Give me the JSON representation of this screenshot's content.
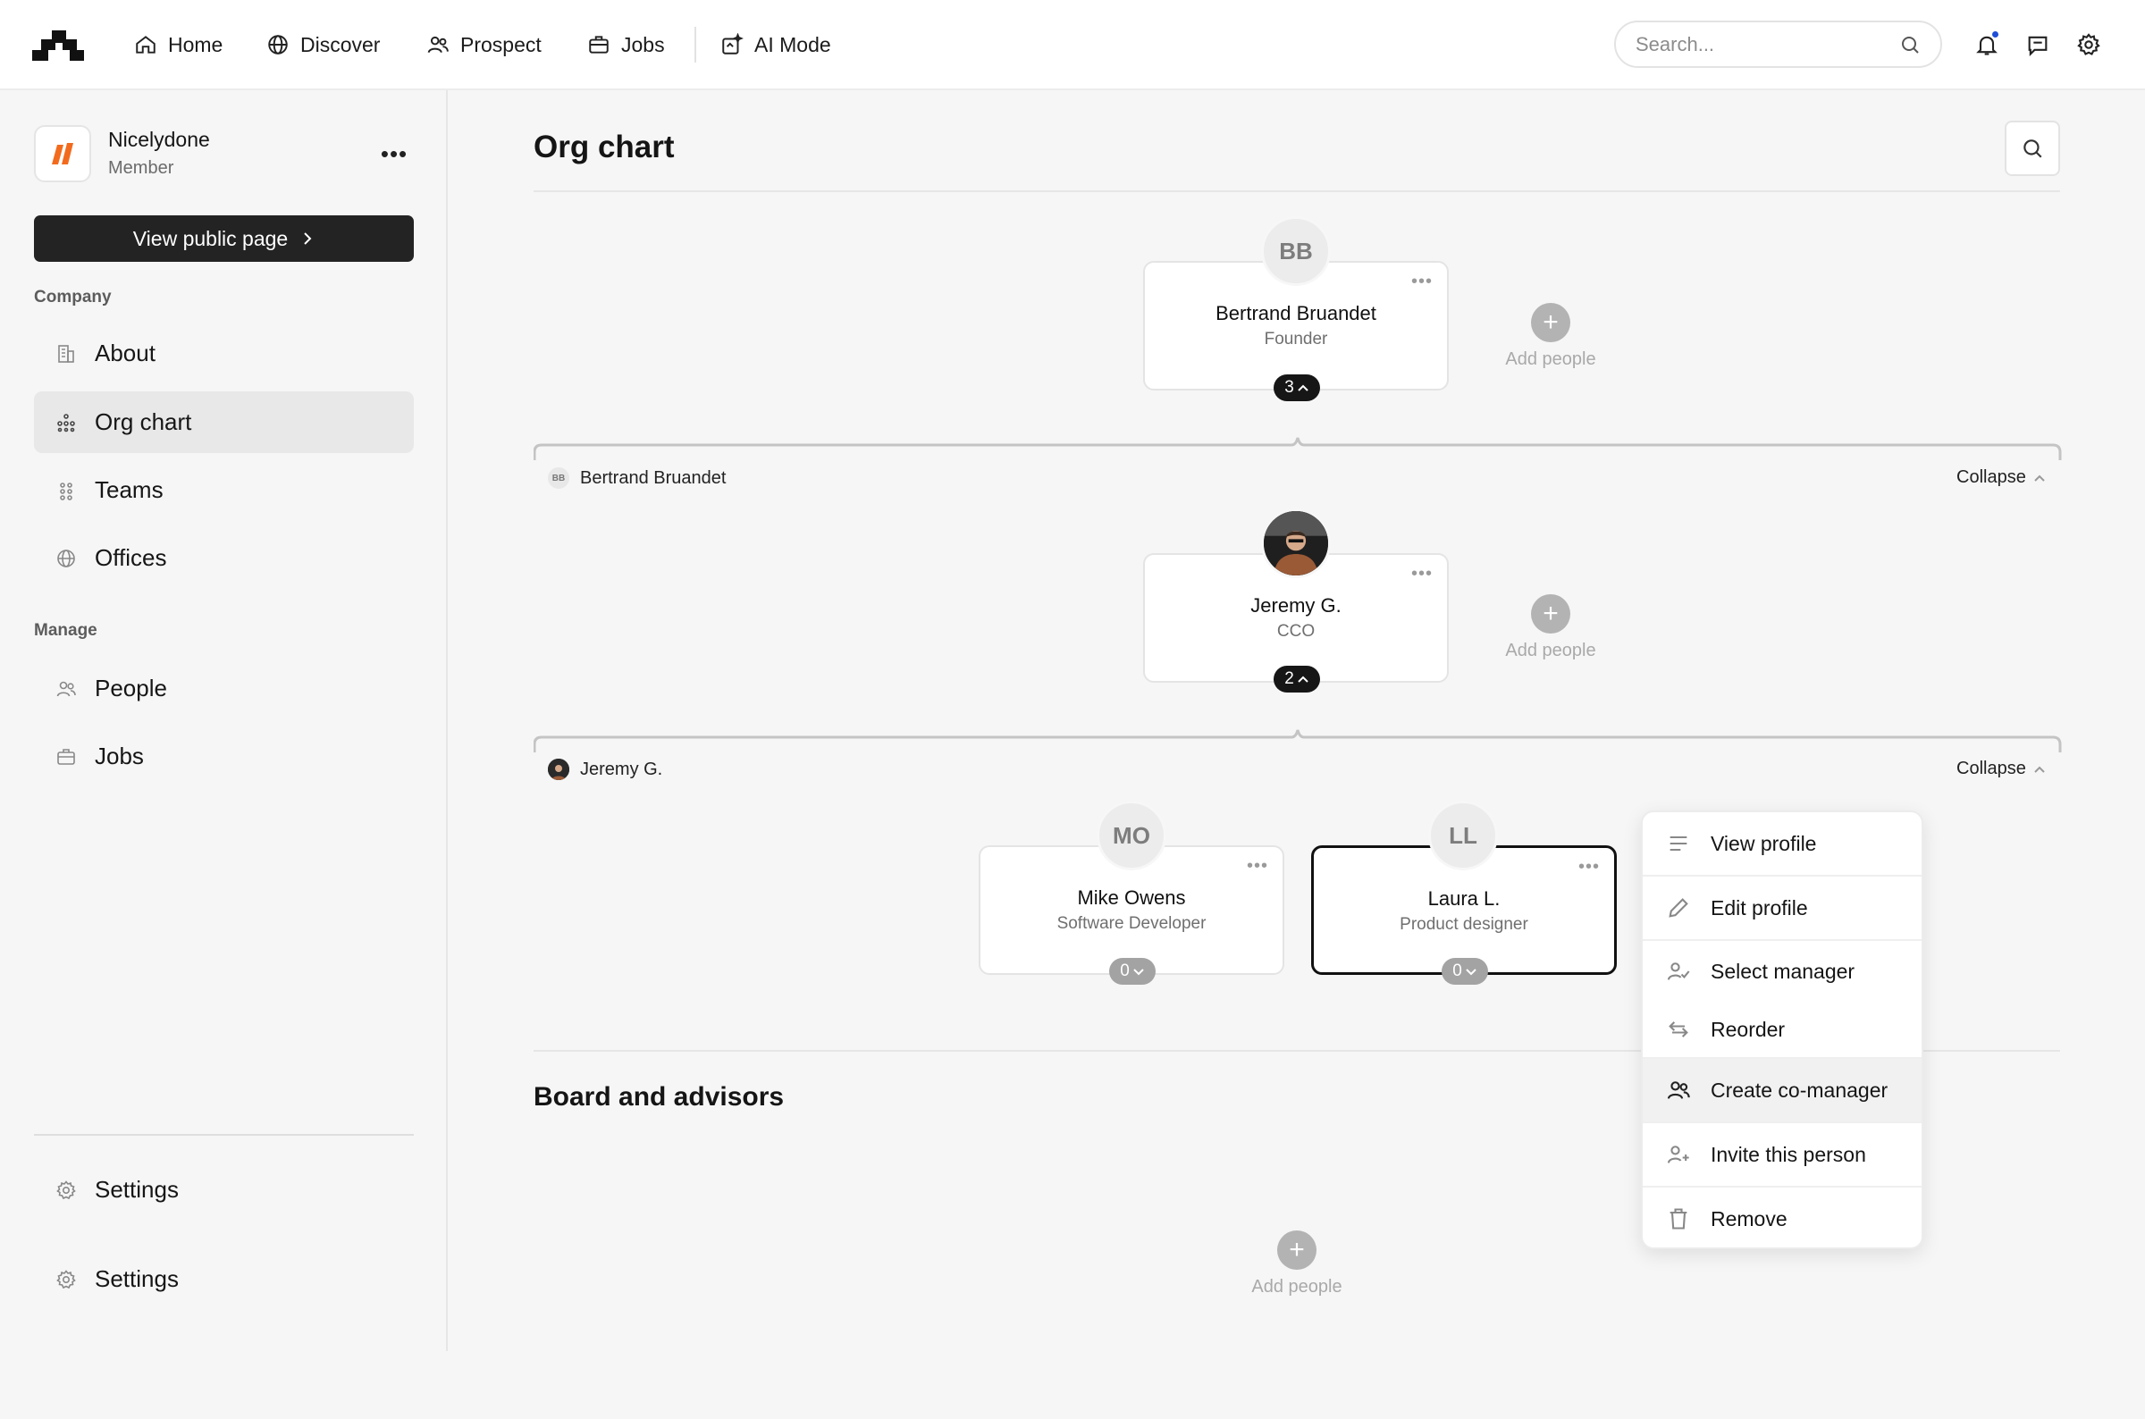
{
  "topbar": {
    "nav": [
      {
        "label": "Home",
        "icon": "home-icon"
      },
      {
        "label": "Discover",
        "icon": "globe-icon"
      },
      {
        "label": "Prospect",
        "icon": "users-icon"
      },
      {
        "label": "Jobs",
        "icon": "briefcase-icon"
      },
      {
        "label": "AI Mode",
        "icon": "ai-sparkle-icon"
      }
    ],
    "search_placeholder": "Search..."
  },
  "sidebar": {
    "company_name": "Nicelydone",
    "company_role": "Member",
    "more_label": "•••",
    "public_button": "View public page",
    "company_section": "Company",
    "manage_section": "Manage",
    "company_items": [
      {
        "label": "About",
        "icon": "building-icon"
      },
      {
        "label": "Org chart",
        "icon": "org-chart-icon"
      },
      {
        "label": "Teams",
        "icon": "teams-icon"
      },
      {
        "label": "Offices",
        "icon": "globe-icon"
      }
    ],
    "manage_items": [
      {
        "label": "People",
        "icon": "people-icon"
      },
      {
        "label": "Jobs",
        "icon": "briefcase-icon"
      }
    ],
    "footer_items": [
      {
        "label": "Settings",
        "icon": "gear-icon"
      },
      {
        "label": "Settings",
        "icon": "gear-icon"
      }
    ]
  },
  "main": {
    "title": "Org chart",
    "board_title": "Board and advisors",
    "add_people_label": "Add people",
    "collapse_label": "Collapse",
    "more_label": "•••",
    "people": {
      "founder": {
        "initials": "BB",
        "name": "Bertrand Bruandet",
        "role": "Founder",
        "reports": "3"
      },
      "cco": {
        "name": "Jeremy G.",
        "role": "CCO",
        "reports": "2"
      },
      "dev": {
        "initials": "MO",
        "name": "Mike Owens",
        "role": "Software Developer",
        "reports": "0"
      },
      "designer": {
        "initials": "LL",
        "name": "Laura L.",
        "role": "Product designer",
        "reports": "0"
      }
    },
    "branches": [
      {
        "initials": "BB",
        "label": "Bertrand Bruandet"
      },
      {
        "label": "Jeremy G."
      }
    ]
  },
  "context_menu": {
    "items": [
      {
        "label": "View profile",
        "icon": "lines-icon"
      },
      {
        "label": "Edit profile",
        "icon": "pencil-icon"
      },
      {
        "label": "Select manager",
        "icon": "user-check-icon"
      },
      {
        "label": "Reorder",
        "icon": "swap-icon"
      },
      {
        "label": "Create co-manager",
        "icon": "users-icon"
      },
      {
        "label": "Invite this person",
        "icon": "user-plus-icon"
      },
      {
        "label": "Remove",
        "icon": "trash-icon"
      }
    ]
  },
  "colors": {
    "brand_orange": "#f26b1d",
    "dark": "#232323",
    "notification": "#1d4ed8"
  }
}
